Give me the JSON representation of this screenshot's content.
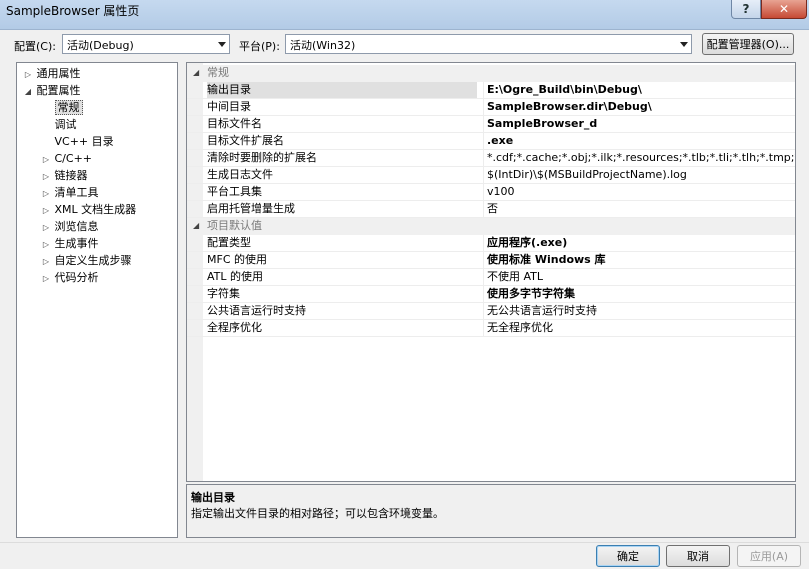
{
  "window": {
    "title": "SampleBrowser 属性页",
    "help_label": "?",
    "close_label": "✕"
  },
  "config": {
    "config_label": "配置(C):",
    "config_value": "活动(Debug)",
    "platform_label": "平台(P):",
    "platform_value": "活动(Win32)",
    "manager_label": "配置管理器(O)..."
  },
  "tree": {
    "items": [
      {
        "label": "通用属性",
        "twisty": "▷"
      },
      {
        "label": "配置属性",
        "twisty": "◢"
      },
      {
        "label": "常规",
        "twisty": ""
      },
      {
        "label": "调试",
        "twisty": ""
      },
      {
        "label": "VC++ 目录",
        "twisty": ""
      },
      {
        "label": "C/C++",
        "twisty": "▷"
      },
      {
        "label": "链接器",
        "twisty": "▷"
      },
      {
        "label": "清单工具",
        "twisty": "▷"
      },
      {
        "label": "XML 文档生成器",
        "twisty": "▷"
      },
      {
        "label": "浏览信息",
        "twisty": "▷"
      },
      {
        "label": "生成事件",
        "twisty": "▷"
      },
      {
        "label": "自定义生成步骤",
        "twisty": "▷"
      },
      {
        "label": "代码分析",
        "twisty": "▷"
      }
    ]
  },
  "grid": {
    "categories": [
      {
        "label": "常规",
        "twisty": "◢"
      },
      {
        "label": "项目默认值",
        "twisty": "◢"
      }
    ],
    "general": [
      {
        "name": "输出目录",
        "value": "E:\\Ogre_Build\\bin\\Debug\\"
      },
      {
        "name": "中间目录",
        "value": "SampleBrowser.dir\\Debug\\"
      },
      {
        "name": "目标文件名",
        "value": "SampleBrowser_d"
      },
      {
        "name": "目标文件扩展名",
        "value": ".exe"
      },
      {
        "name": "清除时要删除的扩展名",
        "value": "*.cdf;*.cache;*.obj;*.ilk;*.resources;*.tlb;*.tli;*.tlh;*.tmp;*.rsp;*.pgc"
      },
      {
        "name": "生成日志文件",
        "value": "$(IntDir)\\$(MSBuildProjectName).log"
      },
      {
        "name": "平台工具集",
        "value": "v100"
      },
      {
        "name": "启用托管增量生成",
        "value": "否"
      }
    ],
    "defaults": [
      {
        "name": "配置类型",
        "value": "应用程序(.exe)"
      },
      {
        "name": "MFC 的使用",
        "value": "使用标准 Windows 库"
      },
      {
        "name": "ATL 的使用",
        "value": "不使用 ATL"
      },
      {
        "name": "字符集",
        "value": "使用多字节字符集"
      },
      {
        "name": "公共语言运行时支持",
        "value": "无公共语言运行时支持"
      },
      {
        "name": "全程序优化",
        "value": "无全程序优化"
      }
    ]
  },
  "description": {
    "title": "输出目录",
    "text": "指定输出文件目录的相对路径；可以包含环境变量。"
  },
  "buttons": {
    "ok": "确定",
    "cancel": "取消",
    "apply": "应用(A)"
  }
}
